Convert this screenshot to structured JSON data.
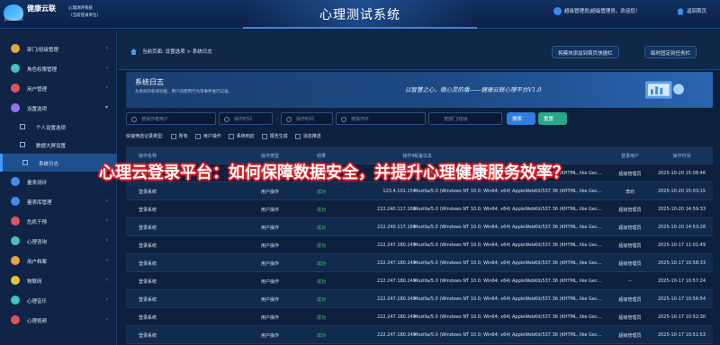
{
  "header": {
    "brand": "健康云联",
    "brand_en": "JKYUNLINK",
    "system": "心理测评系统",
    "subtitle": "（当前登录单位）",
    "title": "心理测试系统",
    "user": "超级管理员|超级管理员，欢迎您！",
    "home": "返回首页"
  },
  "sidebar": {
    "items": [
      {
        "label": "部门/班级管理",
        "color": "#e8a53a"
      },
      {
        "label": "角色权限管理",
        "color": "#3fc6b8"
      },
      {
        "label": "用户管理",
        "color": "#e2545b"
      },
      {
        "label": "设置选项",
        "color": "#9c6ff2"
      },
      {
        "label": "量表测评",
        "color": "#3d8df0"
      },
      {
        "label": "量表库管理",
        "color": "#3d8df0"
      },
      {
        "label": "危机干预",
        "color": "#e2545b"
      },
      {
        "label": "心理咨询",
        "color": "#3fc6b8"
      },
      {
        "label": "用户档案",
        "color": "#e8a53a"
      },
      {
        "label": "物联网",
        "color": "#e8c23a"
      },
      {
        "label": "心理音乐",
        "color": "#3fc6b8"
      },
      {
        "label": "心理视频",
        "color": "#e2545b"
      }
    ],
    "sub": [
      "个人设置选项",
      "数据大屏设置",
      "系统日志"
    ]
  },
  "crumb": {
    "text": "当前页面: 设置选项 > 系统日志",
    "pin_button": "将模块添加到首页快捷栏",
    "fix_button": "临时固定到任务栏"
  },
  "banner": {
    "title": "系统日志",
    "desc": "为系统内各项功能、用户的使用行为等事件进行记录。",
    "slogan": "以智慧之心，做心灵的盾——健康云联心理平台V1.0"
  },
  "filters": {
    "user_placeholder": "按操作者用户",
    "time_from": "操作时间",
    "time_to": "操作时间",
    "ip_placeholder": "按操作IP",
    "dept_placeholder": "按部门/班级",
    "search": "搜索",
    "reset": "重置"
  },
  "quick": {
    "label": "快速筛选记录类型:",
    "options": [
      "所有",
      "用户操作",
      "系统响应",
      "报告生成",
      "消息推送"
    ]
  },
  "table": {
    "headers": [
      "操作名称",
      "操作类型",
      "结果",
      "操作IP",
      "设备信息",
      "登录用户",
      "操作时间"
    ],
    "rows": [
      [
        "登录系统",
        "用户操作",
        "成功",
        "",
        "Mozilla/5.0 (Windows NT 10.0; Win64; x64) AppleWebKit/537.36 (KHTML, like Gec...",
        "超级管理员",
        "2025-10-20 15:08:46"
      ],
      [
        "登录系统",
        "用户操作",
        "成功",
        "123.4.101.154",
        "Mozilla/5.0 (Windows NT 10.0; Win64; x64) AppleWebKit/537.36 (KHTML, like Gec...",
        "李欣",
        "2025-10-20 15:03:15"
      ],
      [
        "登录系统",
        "用户操作",
        "成功",
        "222.240.117.168",
        "Mozilla/5.0 (Windows NT 10.0; Win64; x64) AppleWebKit/537.36 (KHTML, like Gec...",
        "超级管理员",
        "2025-10-20 14:59:33"
      ],
      [
        "登录系统",
        "用户操作",
        "成功",
        "222.240.117.168",
        "Mozilla/5.0 (Windows NT 10.0; Win64; x64) AppleWebKit/537.36 (KHTML, like Gec...",
        "超级管理员",
        "2025-10-20 14:53:28"
      ],
      [
        "登录系统",
        "用户操作",
        "成功",
        "222.247.180.249",
        "Mozilla/5.0 (Windows NT 10.0; Win64; x64) AppleWebKit/537.36 (KHTML, like Gec...",
        "超级管理员",
        "2025-10-17 11:01:49"
      ],
      [
        "登录系统",
        "用户操作",
        "成功",
        "222.247.180.249",
        "Mozilla/5.0 (Windows NT 10.0; Win64; x64) AppleWebKit/537.36 (KHTML, like Gec...",
        "超级管理员",
        "2025-10-17 10:58:33"
      ],
      [
        "登录系统",
        "用户操作",
        "成功",
        "222.247.180.249",
        "Mozilla/5.0 (Windows NT 10.0; Win64; x64) AppleWebKit/537.36 (KHTML, like Gec...",
        "--",
        "2025-10-17 10:57:24"
      ],
      [
        "登录系统",
        "用户操作",
        "成功",
        "222.247.180.249",
        "Mozilla/5.0 (Windows NT 10.0; Win64; x64) AppleWebKit/537.36 (KHTML, like Gec...",
        "超级管理员",
        "2025-10-17 10:56:54"
      ],
      [
        "登录系统",
        "用户操作",
        "成功",
        "222.247.180.249",
        "Mozilla/5.0 (Windows NT 10.0; Win64; x64) AppleWebKit/537.36 (KHTML, like Gec...",
        "超级管理员",
        "2025-10-17 10:52:30"
      ],
      [
        "登录系统",
        "用户操作",
        "成功",
        "222.247.180.249",
        "Mozilla/5.0 (Windows NT 10.0; Win64; x64) AppleWebKit/537.36 (KHTML, like Gec...",
        "超级管理员",
        "2025-10-17 10:51:53"
      ],
      [
        "登录系统",
        "用户操作",
        "成功",
        "222.247.181.38",
        "Mozilla/5.0 (Windows NT 10.0; Win64; x64) AppleWebKit/537.36 (KHTML, like Gec...",
        "超级管理员",
        "2025-10-13 14:30:46"
      ]
    ]
  },
  "overlay": "心理云登录平台：如何保障数据安全，并提升心理健康服务效率？"
}
